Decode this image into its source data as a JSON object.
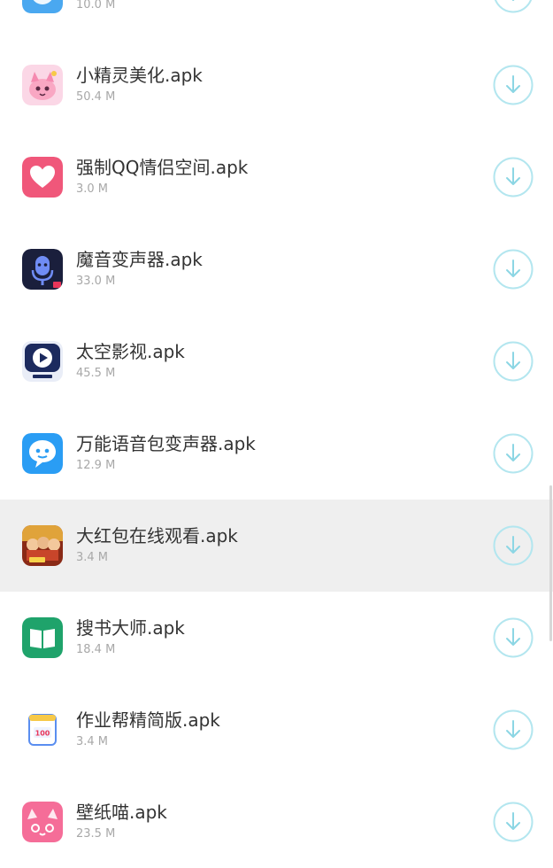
{
  "files": [
    {
      "name": "",
      "size": "10.0 M",
      "icon": "blue-app-icon",
      "color": "#4aa8f0",
      "highlight": false
    },
    {
      "name": "小精灵美化.apk",
      "size": "50.4 M",
      "icon": "pink-cartoon-cat-icon",
      "color": "#f9a7c3",
      "highlight": false
    },
    {
      "name": "强制QQ情侣空间.apk",
      "size": "3.0 M",
      "icon": "heart-icon",
      "color": "#f0577a",
      "highlight": false
    },
    {
      "name": "魔音变声器.apk",
      "size": "33.0 M",
      "icon": "microphone-icon",
      "color": "#1a1f3c",
      "highlight": false
    },
    {
      "name": "太空影视.apk",
      "size": "45.5 M",
      "icon": "play-icon",
      "color": "#1c2a5e",
      "highlight": false
    },
    {
      "name": "万能语音包变声器.apk",
      "size": "12.9 M",
      "icon": "chat-bubble-icon",
      "color": "#2a9df4",
      "highlight": false
    },
    {
      "name": "大红包在线观看.apk",
      "size": "3.4 M",
      "icon": "movie-poster-icon",
      "color": "#c8452a",
      "highlight": true
    },
    {
      "name": "搜书大师.apk",
      "size": "18.4 M",
      "icon": "book-icon",
      "color": "#1fa36b",
      "highlight": false
    },
    {
      "name": "作业帮精简版.apk",
      "size": "3.4 M",
      "icon": "notebook-icon",
      "color": "#ffffff",
      "highlight": false
    },
    {
      "name": "壁纸喵.apk",
      "size": "23.5 M",
      "icon": "cat-face-icon",
      "color": "#f56d98",
      "highlight": false
    }
  ],
  "colors": {
    "download_ring": "#b3e6ef",
    "download_arrow": "#8cd6e4",
    "highlight_row": "#efefef"
  }
}
